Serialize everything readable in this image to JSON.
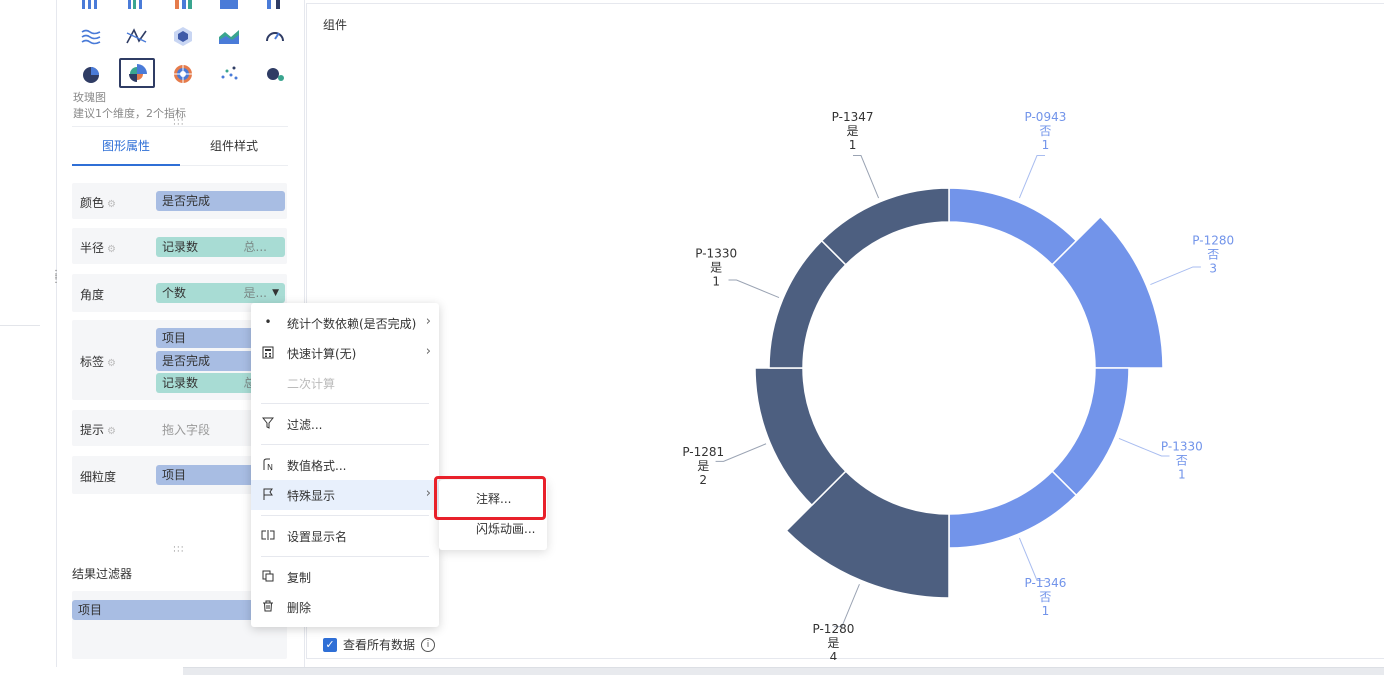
{
  "panel": {
    "chart_name": "玫瑰图",
    "chart_hint": "建议1个维度，2个指标",
    "tabs": [
      "图形属性",
      "组件样式"
    ],
    "rows": {
      "color": {
        "label": "颜色",
        "pill": "是否完成"
      },
      "radius": {
        "label": "半径",
        "pill": "记录数",
        "agg": "总..."
      },
      "angle": {
        "label": "角度",
        "pill": "个数",
        "agg": "是..."
      },
      "label": {
        "label": "标签",
        "pills": [
          "项目",
          "是否完成",
          "记录数"
        ],
        "agg": "总..."
      },
      "tooltip": {
        "label": "提示",
        "placeholder": "拖入字段"
      },
      "granularity": {
        "label": "细粒度",
        "pill": "项目"
      }
    },
    "result_filter": {
      "title": "结果过滤器",
      "pill": "项目"
    }
  },
  "canvas": {
    "title": "组件",
    "view_all_label": "查看所有数据"
  },
  "context_menu": {
    "items": {
      "stat_dependency": "统计个数依赖(是否完成)",
      "quick_calc": "快速计算(无)",
      "secondary_calc": "二次计算",
      "filter": "过滤...",
      "number_format": "数值格式...",
      "special_display": "特殊显示",
      "set_display_name": "设置显示名",
      "copy": "复制",
      "delete": "删除"
    },
    "submenu": {
      "annotate": "注释...",
      "flash_animation": "闪烁动画..."
    }
  },
  "colors": {
    "no": "#7294ea",
    "yes": "#4d5f80",
    "accent": "#2f6fd6",
    "highlight": "#e8202a"
  },
  "chart_data": {
    "type": "rose",
    "dimension": "项目",
    "color_field": "是否完成",
    "series": [
      {
        "name": "否",
        "color": "#7294ea"
      },
      {
        "name": "是",
        "color": "#4d5f80"
      }
    ],
    "slices": [
      {
        "project": "P-0943",
        "done": "否",
        "count": "1",
        "value": 1
      },
      {
        "project": "P-1280",
        "done": "否",
        "count": "3",
        "value": 3
      },
      {
        "project": "P-1330",
        "done": "否",
        "count": "1",
        "value": 1
      },
      {
        "project": "P-1346",
        "done": "否",
        "count": "1",
        "value": 1
      },
      {
        "project": "P-1280",
        "done": "是",
        "count": "4",
        "value": 4
      },
      {
        "project": "P-1281",
        "done": "是",
        "count": "2",
        "value": 2
      },
      {
        "project": "P-1330",
        "done": "是",
        "count": "1",
        "value": 1
      },
      {
        "project": "P-1347",
        "done": "是",
        "count": "1",
        "value": 1
      }
    ]
  }
}
